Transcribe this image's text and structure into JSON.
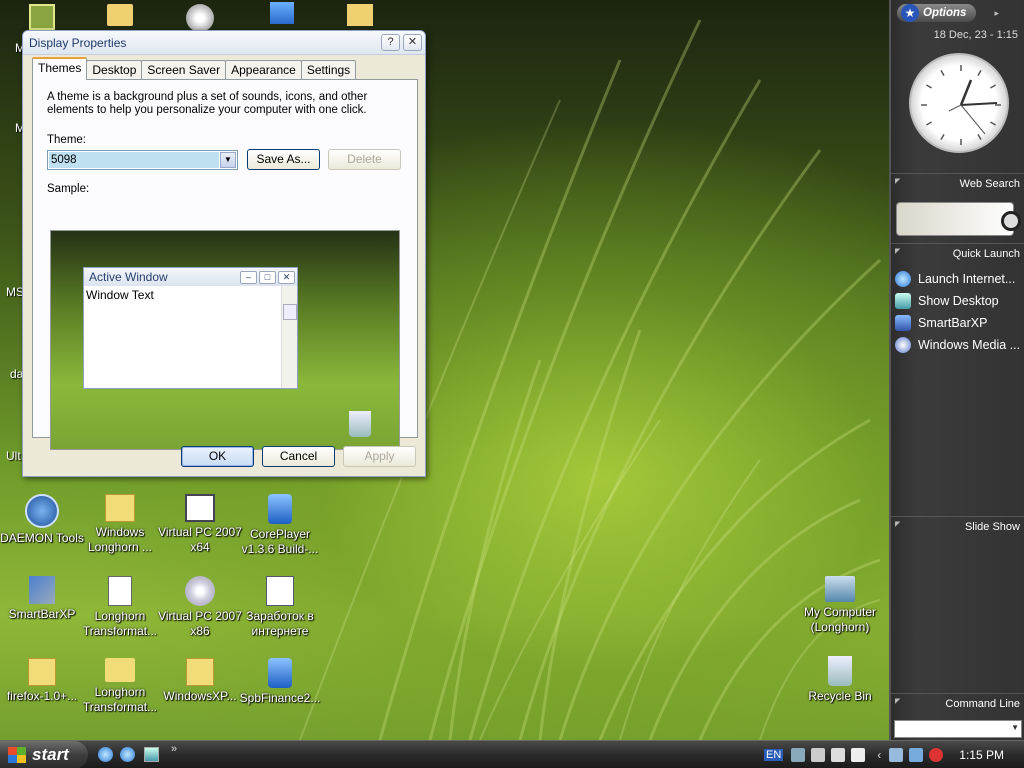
{
  "desktop": {
    "icons": [
      {
        "name": "daemon-tools-icon",
        "label": "DAEMON Tools"
      },
      {
        "name": "windows-longhorn-folder-icon",
        "label": "Windows Longhorn ..."
      },
      {
        "name": "virtual-pc-x64-icon",
        "label": "Virtual PC 2007 x64"
      },
      {
        "name": "coreplayer-icon",
        "label": "CorePlayer v1.3.6 Build-..."
      },
      {
        "name": "smartbarxp-desktop-icon",
        "label": "SmartBarXP"
      },
      {
        "name": "longhorn-transformation-zip-icon",
        "label": "Longhorn Transformat..."
      },
      {
        "name": "virtual-pc-x86-icon",
        "label": "Virtual PC 2007 x86"
      },
      {
        "name": "word-document-icon",
        "label": "Заработок в интернете"
      },
      {
        "name": "firefox-zip-icon",
        "label": "firefox-1.0+..."
      },
      {
        "name": "longhorn-transformation-folder-icon",
        "label": "Longhorn Transformat..."
      },
      {
        "name": "windowsxp-zip-icon",
        "label": "WindowsXP..."
      },
      {
        "name": "spbfinance-icon",
        "label": "SpbFinance2..."
      },
      {
        "name": "my-computer-icon",
        "label": "My Computer (Longhorn)"
      },
      {
        "name": "recycle-bin-icon",
        "label": "Recycle Bin"
      }
    ],
    "partial_labels": [
      "M",
      "M",
      "MS",
      "da",
      "Ult"
    ]
  },
  "dialog": {
    "title": "Display Properties",
    "help": "?",
    "close": "✕",
    "tabs": [
      "Themes",
      "Desktop",
      "Screen Saver",
      "Appearance",
      "Settings"
    ],
    "description": "A theme is a background plus a set of sounds, icons, and other elements to help you personalize your computer with one click.",
    "theme_label": "Theme:",
    "theme_value": "5098",
    "save_as": "Save As...",
    "delete": "Delete",
    "sample_label": "Sample:",
    "sample": {
      "window_title": "Active Window",
      "window_text": "Window Text"
    },
    "ok": "OK",
    "cancel": "Cancel",
    "apply": "Apply"
  },
  "sidebar": {
    "options": "Options",
    "date_time": "18 Dec, 23 - 1:15",
    "web_search": "Web Search",
    "quick_launch": "Quick Launch",
    "quick_items": [
      "Launch Internet...",
      "Show Desktop",
      "SmartBarXP",
      "Windows Media ..."
    ],
    "slide_show": "Slide Show",
    "command_line": "Command Line"
  },
  "taskbar": {
    "start": "start",
    "lang": "EN",
    "time": "1:15 PM"
  },
  "colors": {
    "dialog_bg": "#ece9d8",
    "tab_accent": "#e6a33c",
    "sidebar_bg": "#333333",
    "taskbar_bg": "#2b2b2b"
  }
}
